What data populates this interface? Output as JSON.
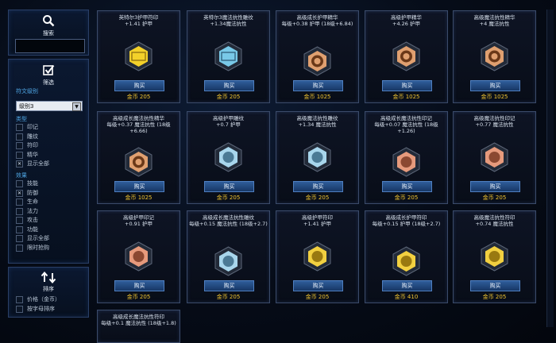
{
  "colors": {
    "accent": "#4fa7e6",
    "gold": "#f0c430",
    "button": "#1f4a86"
  },
  "search": {
    "label": "搜索",
    "icon": "search-icon",
    "value": ""
  },
  "filter": {
    "label": "筛选",
    "icon": "checkbox-icon",
    "tier_label": "符文级别",
    "tier_value": "级别3",
    "type_label": "类型",
    "types": [
      {
        "label": "印记",
        "checked": false
      },
      {
        "label": "雕纹",
        "checked": false
      },
      {
        "label": "符印",
        "checked": false
      },
      {
        "label": "精华",
        "checked": false
      },
      {
        "label": "显示全部",
        "checked": true
      }
    ],
    "effect_label": "效果",
    "effects": [
      {
        "label": "技能",
        "checked": false
      },
      {
        "label": "防御",
        "checked": true
      },
      {
        "label": "生命",
        "checked": false
      },
      {
        "label": "法力",
        "checked": false
      },
      {
        "label": "攻击",
        "checked": false
      },
      {
        "label": "功能",
        "checked": false
      },
      {
        "label": "显示全部",
        "checked": false
      },
      {
        "label": "限时抢购",
        "checked": false
      }
    ]
  },
  "sort": {
    "label": "排序",
    "icon": "sort-arrows-icon",
    "options": [
      {
        "label": "价格（金币）",
        "checked": false
      },
      {
        "label": "按字母排序",
        "checked": false
      }
    ]
  },
  "store": {
    "buy_label": "购买",
    "items": [
      {
        "name": "英特尔3护甲符印",
        "desc": "+1.41 护甲",
        "price": "金币 205",
        "icon": "core-yellow-rune-icon"
      },
      {
        "name": "英特尔3魔法抗性雕纹",
        "desc": "+1.34魔法抗性",
        "price": "金币 205",
        "icon": "core-blue-rune-icon"
      },
      {
        "name": "高级成长护甲精华",
        "desc": "每级+0.38 护甲 (18级+6.84)",
        "price": "金币 1025",
        "icon": "lion-quintessence-icon"
      },
      {
        "name": "高级护甲精华",
        "desc": "+4.26 护甲",
        "price": "金币 1025",
        "icon": "dragon-quintessence-icon"
      },
      {
        "name": "高级魔法抗性精华",
        "desc": "+4 魔法抗性",
        "price": "金币 1025",
        "icon": "ram-quintessence-icon"
      },
      {
        "name": "高级成长魔法抗性精华",
        "desc": "每级+0.37 魔法抗性 (18级+6.66)",
        "price": "金币 1025",
        "icon": "tree-quintessence-icon"
      },
      {
        "name": "高级护甲雕纹",
        "desc": "+0.7 护甲",
        "price": "金币 205",
        "icon": "tower-glyph-icon"
      },
      {
        "name": "高级魔法抗性雕纹",
        "desc": "+1.34 魔法抗性",
        "price": "金币 205",
        "icon": "swirl-glyph-icon"
      },
      {
        "name": "高级成长魔法抗性印记",
        "desc": "每级+0.07 魔法抗性 (18级+1.26)",
        "price": "金币 205",
        "icon": "hand-mark-icon"
      },
      {
        "name": "高级魔法抗性印记",
        "desc": "+0.77 魔法抗性",
        "price": "金币 205",
        "icon": "potion-mark-icon"
      },
      {
        "name": "高级护甲印记",
        "desc": "+0.91 护甲",
        "price": "金币 205",
        "icon": "crossed-swords-mark-icon"
      },
      {
        "name": "高级成长魔法抗性雕纹",
        "desc": "每级+0.15 魔法抗性 (18级+2.7)",
        "price": "金币 205",
        "icon": "wand-glyph-icon"
      },
      {
        "name": "高级护甲符印",
        "desc": "+1.41 护甲",
        "price": "金币 205",
        "icon": "chalice-seal-icon"
      },
      {
        "name": "高级成长护甲符印",
        "desc": "每级+0.15 护甲 (18级+2.7)",
        "price": "金币 410",
        "icon": "shield-seal-icon"
      },
      {
        "name": "高级魔法抗性符印",
        "desc": "+0.74 魔法抗性",
        "price": "金币 205",
        "icon": "horn-seal-icon"
      },
      {
        "name": "高级成长魔法抗性符印",
        "desc": "每级+0.1 魔法抗性 (18级+1.8)",
        "price": "",
        "icon": "seal-icon"
      }
    ]
  }
}
